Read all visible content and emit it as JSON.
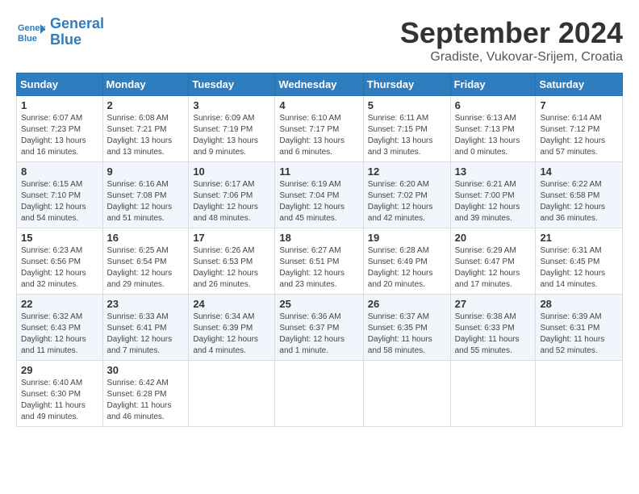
{
  "logo": {
    "line1": "General",
    "line2": "Blue"
  },
  "title": "September 2024",
  "location": "Gradiste, Vukovar-Srijem, Croatia",
  "weekdays": [
    "Sunday",
    "Monday",
    "Tuesday",
    "Wednesday",
    "Thursday",
    "Friday",
    "Saturday"
  ],
  "weeks": [
    [
      {
        "day": "1",
        "info": "Sunrise: 6:07 AM\nSunset: 7:23 PM\nDaylight: 13 hours\nand 16 minutes."
      },
      {
        "day": "2",
        "info": "Sunrise: 6:08 AM\nSunset: 7:21 PM\nDaylight: 13 hours\nand 13 minutes."
      },
      {
        "day": "3",
        "info": "Sunrise: 6:09 AM\nSunset: 7:19 PM\nDaylight: 13 hours\nand 9 minutes."
      },
      {
        "day": "4",
        "info": "Sunrise: 6:10 AM\nSunset: 7:17 PM\nDaylight: 13 hours\nand 6 minutes."
      },
      {
        "day": "5",
        "info": "Sunrise: 6:11 AM\nSunset: 7:15 PM\nDaylight: 13 hours\nand 3 minutes."
      },
      {
        "day": "6",
        "info": "Sunrise: 6:13 AM\nSunset: 7:13 PM\nDaylight: 13 hours\nand 0 minutes."
      },
      {
        "day": "7",
        "info": "Sunrise: 6:14 AM\nSunset: 7:12 PM\nDaylight: 12 hours\nand 57 minutes."
      }
    ],
    [
      {
        "day": "8",
        "info": "Sunrise: 6:15 AM\nSunset: 7:10 PM\nDaylight: 12 hours\nand 54 minutes."
      },
      {
        "day": "9",
        "info": "Sunrise: 6:16 AM\nSunset: 7:08 PM\nDaylight: 12 hours\nand 51 minutes."
      },
      {
        "day": "10",
        "info": "Sunrise: 6:17 AM\nSunset: 7:06 PM\nDaylight: 12 hours\nand 48 minutes."
      },
      {
        "day": "11",
        "info": "Sunrise: 6:19 AM\nSunset: 7:04 PM\nDaylight: 12 hours\nand 45 minutes."
      },
      {
        "day": "12",
        "info": "Sunrise: 6:20 AM\nSunset: 7:02 PM\nDaylight: 12 hours\nand 42 minutes."
      },
      {
        "day": "13",
        "info": "Sunrise: 6:21 AM\nSunset: 7:00 PM\nDaylight: 12 hours\nand 39 minutes."
      },
      {
        "day": "14",
        "info": "Sunrise: 6:22 AM\nSunset: 6:58 PM\nDaylight: 12 hours\nand 36 minutes."
      }
    ],
    [
      {
        "day": "15",
        "info": "Sunrise: 6:23 AM\nSunset: 6:56 PM\nDaylight: 12 hours\nand 32 minutes."
      },
      {
        "day": "16",
        "info": "Sunrise: 6:25 AM\nSunset: 6:54 PM\nDaylight: 12 hours\nand 29 minutes."
      },
      {
        "day": "17",
        "info": "Sunrise: 6:26 AM\nSunset: 6:53 PM\nDaylight: 12 hours\nand 26 minutes."
      },
      {
        "day": "18",
        "info": "Sunrise: 6:27 AM\nSunset: 6:51 PM\nDaylight: 12 hours\nand 23 minutes."
      },
      {
        "day": "19",
        "info": "Sunrise: 6:28 AM\nSunset: 6:49 PM\nDaylight: 12 hours\nand 20 minutes."
      },
      {
        "day": "20",
        "info": "Sunrise: 6:29 AM\nSunset: 6:47 PM\nDaylight: 12 hours\nand 17 minutes."
      },
      {
        "day": "21",
        "info": "Sunrise: 6:31 AM\nSunset: 6:45 PM\nDaylight: 12 hours\nand 14 minutes."
      }
    ],
    [
      {
        "day": "22",
        "info": "Sunrise: 6:32 AM\nSunset: 6:43 PM\nDaylight: 12 hours\nand 11 minutes."
      },
      {
        "day": "23",
        "info": "Sunrise: 6:33 AM\nSunset: 6:41 PM\nDaylight: 12 hours\nand 7 minutes."
      },
      {
        "day": "24",
        "info": "Sunrise: 6:34 AM\nSunset: 6:39 PM\nDaylight: 12 hours\nand 4 minutes."
      },
      {
        "day": "25",
        "info": "Sunrise: 6:36 AM\nSunset: 6:37 PM\nDaylight: 12 hours\nand 1 minute."
      },
      {
        "day": "26",
        "info": "Sunrise: 6:37 AM\nSunset: 6:35 PM\nDaylight: 11 hours\nand 58 minutes."
      },
      {
        "day": "27",
        "info": "Sunrise: 6:38 AM\nSunset: 6:33 PM\nDaylight: 11 hours\nand 55 minutes."
      },
      {
        "day": "28",
        "info": "Sunrise: 6:39 AM\nSunset: 6:31 PM\nDaylight: 11 hours\nand 52 minutes."
      }
    ],
    [
      {
        "day": "29",
        "info": "Sunrise: 6:40 AM\nSunset: 6:30 PM\nDaylight: 11 hours\nand 49 minutes."
      },
      {
        "day": "30",
        "info": "Sunrise: 6:42 AM\nSunset: 6:28 PM\nDaylight: 11 hours\nand 46 minutes."
      },
      null,
      null,
      null,
      null,
      null
    ]
  ]
}
